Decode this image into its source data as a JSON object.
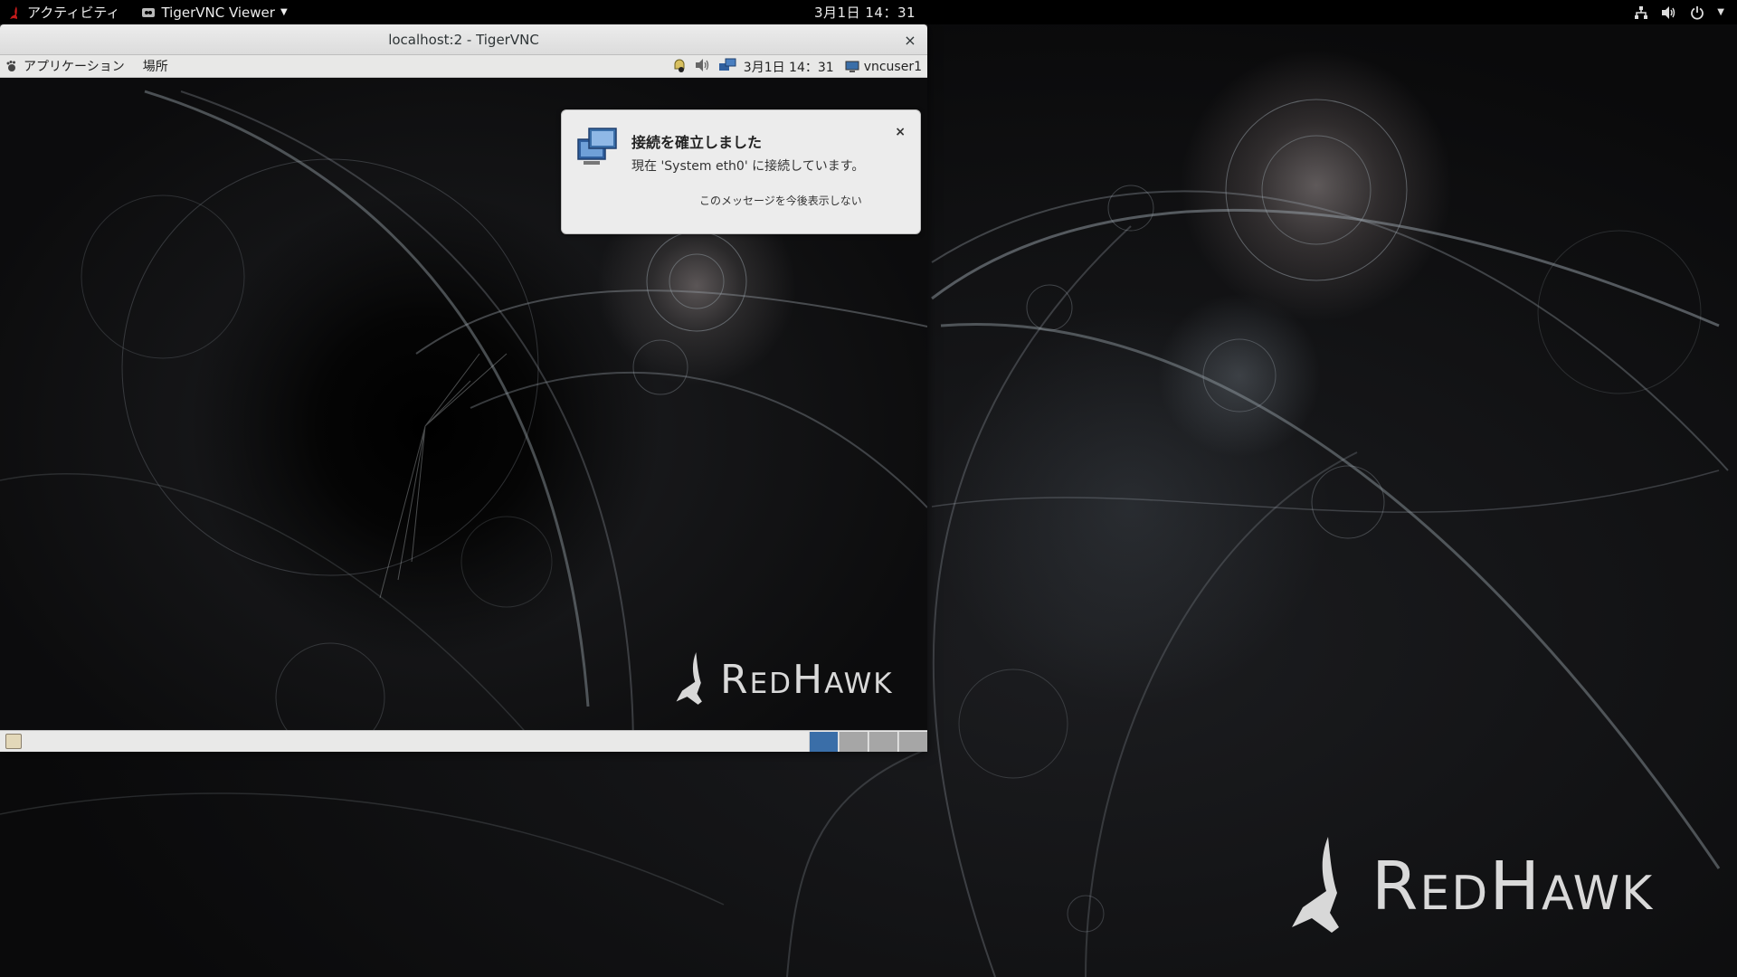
{
  "topbar": {
    "activities_label": "アクティビティ",
    "app_menu_label": "TigerVNC Viewer",
    "clock": "3月1日  14：31",
    "tray_icons": [
      "network-icon",
      "volume-icon",
      "power-icon",
      "chevron-down-icon"
    ]
  },
  "vnc_window": {
    "title": "localhost:2 - TigerVNC",
    "close_glyph": "×"
  },
  "remote_panel": {
    "applications_label": "アプリケーション",
    "places_label": "場所",
    "clock": "3月1日  14：31",
    "user_label": "vncuser1"
  },
  "notification": {
    "title": "接続を確立しました",
    "body": "現在 'System eth0' に接続しています。",
    "action_label": "このメッセージを今後表示しない",
    "close_glyph": "×"
  },
  "remote_taskbar": {
    "workspaces": 4,
    "active_workspace": 1
  },
  "brand": {
    "wordmark": "RedHawk"
  },
  "colors": {
    "topbar": "#000000",
    "panel": "#e8e8e7",
    "active_workspace": "#3a6ea8",
    "inactive_workspace": "#a6a6a6",
    "brand_red": "#cc1d1d"
  }
}
